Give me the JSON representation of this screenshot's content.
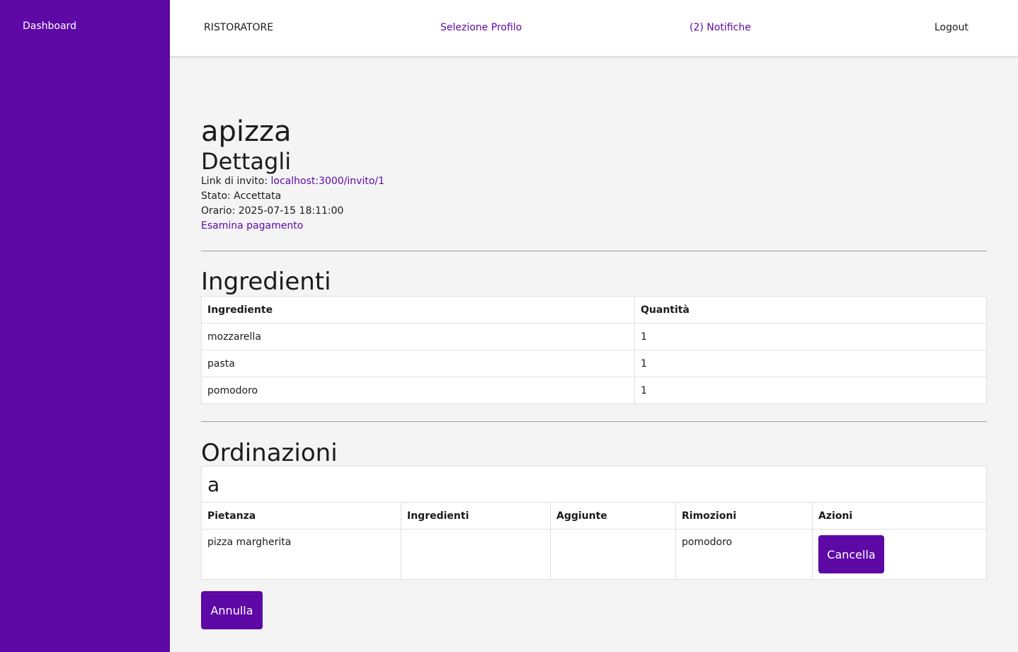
{
  "sidebar": {
    "dashboard_label": "Dashboard"
  },
  "topbar": {
    "brand": "RISTORATORE",
    "profile_link": "Selezione Profilo",
    "notifications_link": "(2) Notifiche",
    "logout_link": "Logout"
  },
  "page": {
    "title": "apizza",
    "subtitle": "Dettagli",
    "invite_label": "Link di invito: ",
    "invite_link": "localhost:3000/invito/1",
    "status": "Stato: Accettata",
    "time": "Orario: 2025-07-15 18:11:00",
    "payment_link": "Esamina pagamento"
  },
  "ingredients": {
    "title": "Ingredienti",
    "headers": [
      "Ingrediente",
      "Quantità"
    ],
    "rows": [
      [
        "mozzarella",
        "1"
      ],
      [
        "pasta",
        "1"
      ],
      [
        "pomodoro",
        "1"
      ]
    ]
  },
  "orders": {
    "title": "Ordinazioni",
    "group_name": "a",
    "headers": [
      "Pietanza",
      "Ingredienti",
      "Aggiunte",
      "Rimozioni",
      "Azioni"
    ],
    "rows": [
      {
        "dish": "pizza margherita",
        "ingredients": "",
        "additions": "",
        "removals": "pomodoro",
        "action": "Cancella"
      }
    ]
  },
  "annulla_label": "Annulla",
  "colors": {
    "accent": "#5e08a6",
    "background": "#f4f4f4"
  }
}
